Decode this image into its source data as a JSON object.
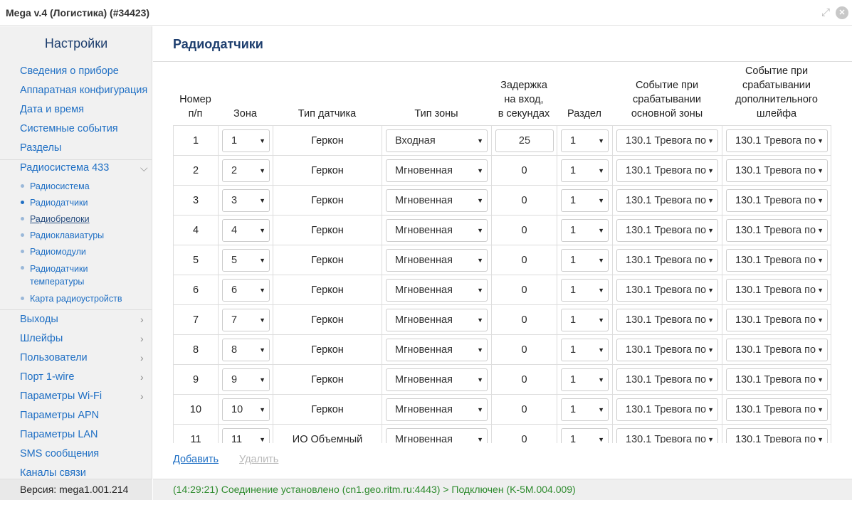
{
  "window": {
    "title": "Mega v.4 (Логистика) (#34423)"
  },
  "sidebar": {
    "title": "Настройки",
    "items_top": [
      {
        "label": "Сведения о приборе"
      },
      {
        "label": "Аппаратная конфигурация"
      },
      {
        "label": "Дата и время"
      },
      {
        "label": "Системные события"
      },
      {
        "label": "Разделы"
      }
    ],
    "radio_group": {
      "label": "Радиосистема 433",
      "subitems": [
        {
          "label": "Радиосистема"
        },
        {
          "label": "Радиодатчики"
        },
        {
          "label": "Радиобрелоки"
        },
        {
          "label": "Радиоклавиатуры"
        },
        {
          "label": "Радиомодули"
        },
        {
          "label": "Радиодатчики температуры"
        },
        {
          "label": "Карта радиоустройств"
        }
      ]
    },
    "items_bottom": [
      {
        "label": "Выходы"
      },
      {
        "label": "Шлейфы"
      },
      {
        "label": "Пользователи"
      },
      {
        "label": "Порт 1-wire"
      },
      {
        "label": "Параметры Wi-Fi"
      },
      {
        "label": "Параметры APN"
      },
      {
        "label": "Параметры LAN"
      },
      {
        "label": "SMS сообщения"
      },
      {
        "label": "Каналы связи"
      }
    ],
    "version": "Версия: mega1.001.214"
  },
  "main": {
    "title": "Радиодатчики",
    "columns": [
      [
        "Номер",
        "п/п"
      ],
      [
        "Зона"
      ],
      [
        "Тип датчика"
      ],
      [
        "Тип зоны"
      ],
      [
        "Задержка",
        "на вход,",
        "в секундах"
      ],
      [
        "Раздел"
      ],
      [
        "Событие при",
        "срабатывании",
        "основной зоны"
      ],
      [
        "Событие при",
        "срабатывании",
        "дополнительного",
        "шлейфа"
      ]
    ],
    "rows": [
      {
        "num": "1",
        "zone": "1",
        "sensor_type": "Геркон",
        "zone_type": "Входная",
        "delay": "25",
        "section": "1",
        "event_main": "130.1 Тревога по",
        "event_extra": "130.1 Тревога по"
      },
      {
        "num": "2",
        "zone": "2",
        "sensor_type": "Геркон",
        "zone_type": "Мгновенная",
        "delay": "0",
        "section": "1",
        "event_main": "130.1 Тревога по",
        "event_extra": "130.1 Тревога по"
      },
      {
        "num": "3",
        "zone": "3",
        "sensor_type": "Геркон",
        "zone_type": "Мгновенная",
        "delay": "0",
        "section": "1",
        "event_main": "130.1 Тревога по",
        "event_extra": "130.1 Тревога по"
      },
      {
        "num": "4",
        "zone": "4",
        "sensor_type": "Геркон",
        "zone_type": "Мгновенная",
        "delay": "0",
        "section": "1",
        "event_main": "130.1 Тревога по",
        "event_extra": "130.1 Тревога по"
      },
      {
        "num": "5",
        "zone": "5",
        "sensor_type": "Геркон",
        "zone_type": "Мгновенная",
        "delay": "0",
        "section": "1",
        "event_main": "130.1 Тревога по",
        "event_extra": "130.1 Тревога по"
      },
      {
        "num": "6",
        "zone": "6",
        "sensor_type": "Геркон",
        "zone_type": "Мгновенная",
        "delay": "0",
        "section": "1",
        "event_main": "130.1 Тревога по",
        "event_extra": "130.1 Тревога по"
      },
      {
        "num": "7",
        "zone": "7",
        "sensor_type": "Геркон",
        "zone_type": "Мгновенная",
        "delay": "0",
        "section": "1",
        "event_main": "130.1 Тревога по",
        "event_extra": "130.1 Тревога по"
      },
      {
        "num": "8",
        "zone": "8",
        "sensor_type": "Геркон",
        "zone_type": "Мгновенная",
        "delay": "0",
        "section": "1",
        "event_main": "130.1 Тревога по",
        "event_extra": "130.1 Тревога по"
      },
      {
        "num": "9",
        "zone": "9",
        "sensor_type": "Геркон",
        "zone_type": "Мгновенная",
        "delay": "0",
        "section": "1",
        "event_main": "130.1 Тревога по",
        "event_extra": "130.1 Тревога по"
      },
      {
        "num": "10",
        "zone": "10",
        "sensor_type": "Геркон",
        "zone_type": "Мгновенная",
        "delay": "0",
        "section": "1",
        "event_main": "130.1 Тревога по",
        "event_extra": "130.1 Тревога по"
      },
      {
        "num": "11",
        "zone": "11",
        "sensor_type": "ИО Объемный",
        "zone_type": "Мгновенная",
        "delay": "0",
        "section": "1",
        "event_main": "130.1 Тревога по",
        "event_extra": "130.1 Тревога по"
      }
    ],
    "actions": {
      "add": "Добавить",
      "delete": "Удалить"
    }
  },
  "status": {
    "text": "(14:29:21) Соединение установлено (cn1.geo.ritm.ru:4443) > Подключен (K-5M.004.009)"
  }
}
